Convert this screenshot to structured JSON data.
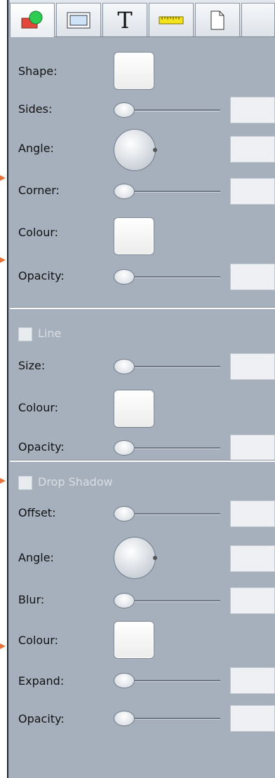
{
  "tabs": [
    {
      "name": "shape-tab",
      "icon": "shape-icon",
      "active": true
    },
    {
      "name": "rectangle-tab",
      "icon": "rectangle-icon",
      "active": false
    },
    {
      "name": "text-tab",
      "icon": "text-icon",
      "label": "T",
      "active": false
    },
    {
      "name": "ruler-tab",
      "icon": "ruler-icon",
      "active": false
    },
    {
      "name": "page-tab",
      "icon": "page-icon",
      "active": false
    }
  ],
  "shape": {
    "shape_label": "Shape:",
    "sides_label": "Sides:",
    "angle_label": "Angle:",
    "corner_label": "Corner:",
    "colour_label": "Colour:",
    "opacity_label": "Opacity:"
  },
  "line": {
    "toggle_label": "Line",
    "size_label": "Size:",
    "colour_label": "Colour:",
    "opacity_label": "Opacity:"
  },
  "drop_shadow": {
    "toggle_label": "Drop Shadow",
    "offset_label": "Offset:",
    "angle_label": "Angle:",
    "blur_label": "Blur:",
    "colour_label": "Colour:",
    "expand_label": "Expand:",
    "opacity_label": "Opacity:"
  },
  "colors": {
    "panel_bg": "#a6b0bc",
    "marker": "#e8733a",
    "swatch": "#ffffff"
  }
}
